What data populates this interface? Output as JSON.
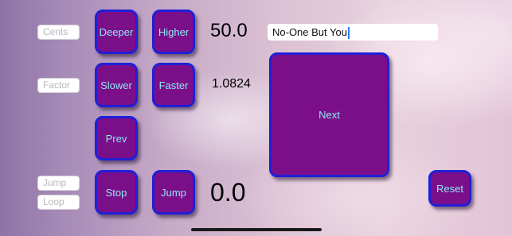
{
  "fields": {
    "cents": "Cents",
    "factor": "Factor",
    "jump": "Jump",
    "loop": "Loop"
  },
  "buttons": {
    "deeper": "Deeper",
    "higher": "Higher",
    "slower": "Slower",
    "faster": "Faster",
    "prev": "Prev",
    "stop": "Stop",
    "jump": "Jump",
    "next": "Next",
    "reset": "Reset"
  },
  "readouts": {
    "cents_value": "50.0",
    "factor_value": "1.0824",
    "jump_value": "0.0"
  },
  "title_field": {
    "value": "No-One But You"
  },
  "colors": {
    "button_fill": "#7b0f8a",
    "button_border": "#1f1fd8",
    "button_text": "#8ee8f2"
  }
}
